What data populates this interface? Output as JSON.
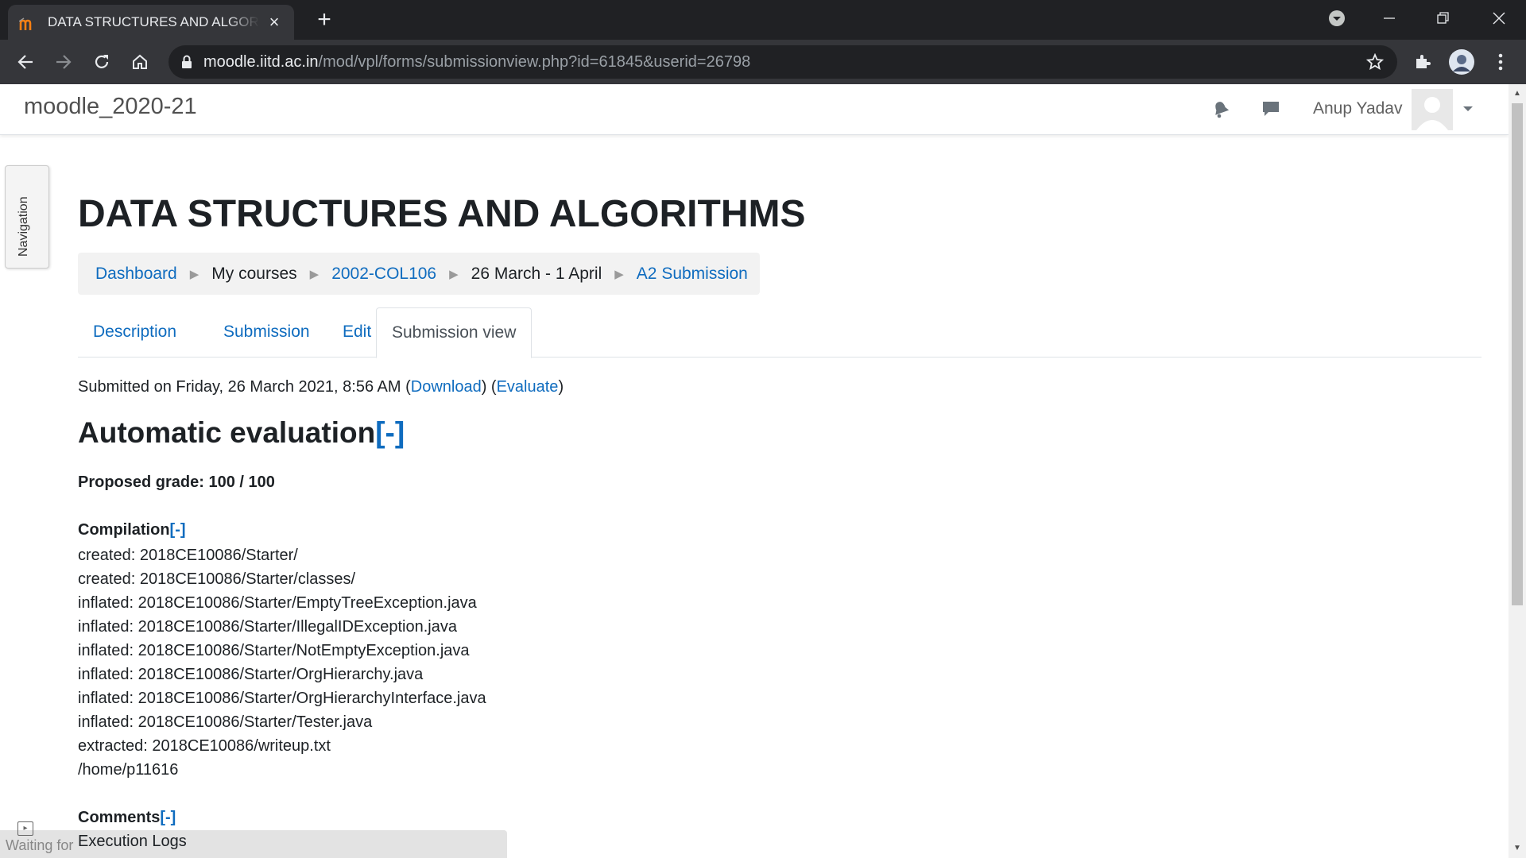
{
  "browser": {
    "tab_title": "DATA STRUCTURES AND ALGORITHMS",
    "url_host": "moodle.iitd.ac.in",
    "url_path": "/mod/vpl/forms/submissionview.php?id=61845&userid=26798"
  },
  "navbar": {
    "site_name": "moodle_2020-21",
    "user_name": "Anup Yadav"
  },
  "drawer": {
    "label": "Navigation"
  },
  "course": {
    "title": "DATA STRUCTURES AND ALGORITHMS"
  },
  "breadcrumb": [
    {
      "label": "Dashboard",
      "link": true
    },
    {
      "label": "My courses",
      "link": false
    },
    {
      "label": "2002-COL106",
      "link": true
    },
    {
      "label": "26 March - 1 April",
      "link": false
    },
    {
      "label": "A2 Submission",
      "link": true
    }
  ],
  "tabs": [
    {
      "label": "Description",
      "active": false
    },
    {
      "label": "Submission",
      "active": false
    },
    {
      "label": "Edit",
      "active": false
    },
    {
      "label": "Submission view",
      "active": true
    }
  ],
  "submission": {
    "submitted_text": "Submitted on Friday, 26 March 2021, 8:56 AM ",
    "download_label": "Download",
    "evaluate_label": "Evaluate",
    "open_paren": "(",
    "close_paren": ")",
    "gap_between": ") ("
  },
  "evaluation": {
    "heading": "Automatic evaluation",
    "toggle": "[-]",
    "proposed_grade": "Proposed grade: 100 / 100",
    "compilation_heading": "Compilation",
    "compilation_lines": [
      "created: 2018CE10086/Starter/",
      "created: 2018CE10086/Starter/classes/",
      "inflated: 2018CE10086/Starter/EmptyTreeException.java",
      "inflated: 2018CE10086/Starter/IllegalIDException.java",
      "inflated: 2018CE10086/Starter/NotEmptyException.java",
      "inflated: 2018CE10086/Starter/OrgHierarchy.java",
      "inflated: 2018CE10086/Starter/OrgHierarchyInterface.java",
      "inflated: 2018CE10086/Starter/Tester.java",
      "extracted: 2018CE10086/writeup.txt",
      "/home/p11616"
    ],
    "comments_heading": "Comments",
    "execution_logs": "Execution Logs"
  },
  "status_bar": {
    "text": "Waiting for"
  }
}
